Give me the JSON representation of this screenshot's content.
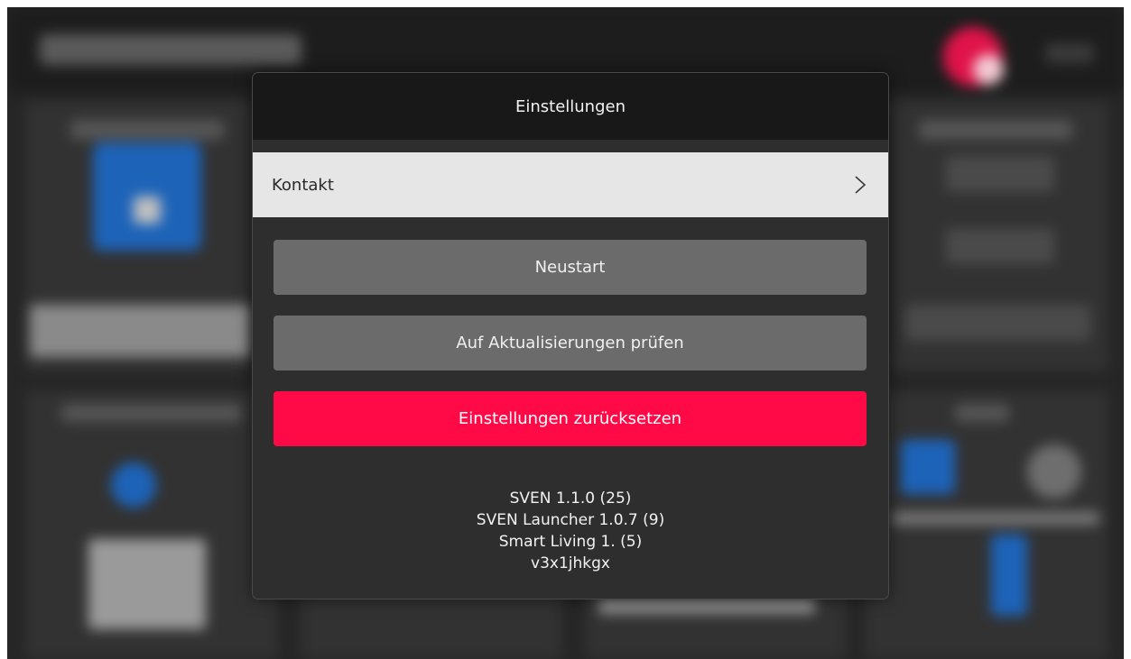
{
  "modal": {
    "title": "Einstellungen",
    "contact_label": "Kontakt",
    "buttons": {
      "restart": "Neustart",
      "check_updates": "Auf Aktualisierungen prüfen",
      "reset_settings": "Einstellungen zurücksetzen"
    },
    "version_info": [
      "SVEN 1.1.0 (25)",
      "SVEN Launcher 1.0.7 (9)",
      "Smart Living 1. (5)",
      "v3x1jhkgx"
    ]
  },
  "colors": {
    "accent": "#ff0a47",
    "header_bg": "#181818",
    "modal_bg": "#2e2e2e",
    "row_bg": "#e6e6e6",
    "button_grey": "#6b6b6b"
  },
  "icons": {
    "contact_row": "chevron-right-icon"
  }
}
